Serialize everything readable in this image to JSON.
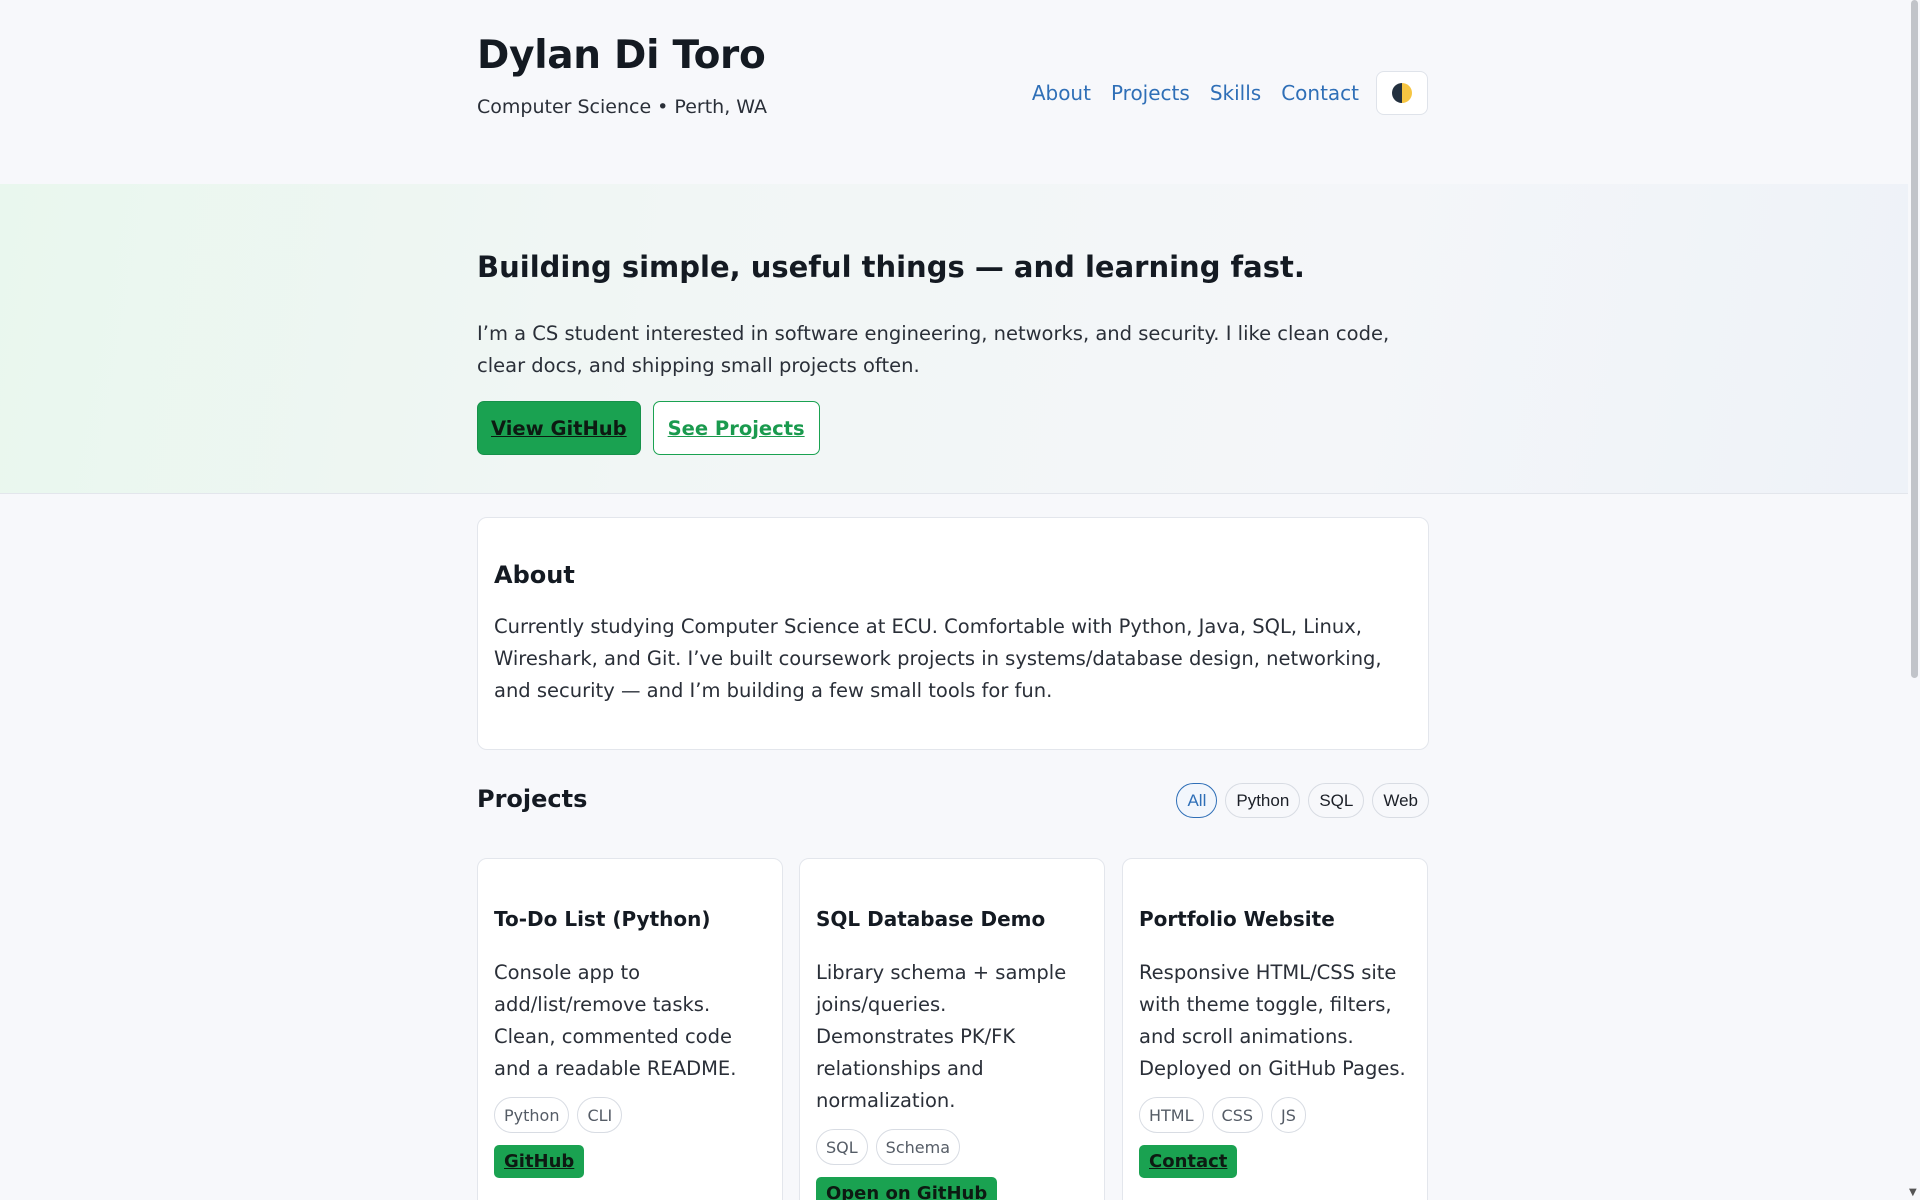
{
  "header": {
    "name": "Dylan Di Toro",
    "subtitle": "Computer Science • Perth, WA",
    "nav": [
      "About",
      "Projects",
      "Skills",
      "Contact"
    ]
  },
  "hero": {
    "title": "Building simple, useful things — and learning fast.",
    "text": "I’m a CS student interested in software engineering, networks, and security. I like clean code, clear docs, and shipping small projects often.",
    "primary_button": "View GitHub",
    "secondary_button": "See Projects"
  },
  "about": {
    "title": "About",
    "text": "Currently studying Computer Science at ECU. Comfortable with Python, Java, SQL, Linux, Wireshark, and Git. I’ve built coursework projects in systems/database design, networking, and security — and I’m building a few small tools for fun."
  },
  "projects": {
    "title": "Projects",
    "filters": [
      "All",
      "Python",
      "SQL",
      "Web"
    ],
    "active_filter": "All",
    "items": [
      {
        "title": "To-Do List (Python)",
        "description": "Console app to add/list/remove tasks. Clean, commented code and a readable README.",
        "tags": [
          "Python",
          "CLI"
        ],
        "button": "GitHub"
      },
      {
        "title": "SQL Database Demo",
        "description": "Library schema + sample joins/queries. Demonstrates PK/FK relationships and normalization.",
        "tags": [
          "SQL",
          "Schema"
        ],
        "button": "Open on GitHub"
      },
      {
        "title": "Portfolio Website",
        "description": "Responsive HTML/CSS site with theme toggle, filters, and scroll animations. Deployed on GitHub Pages.",
        "tags": [
          "HTML",
          "CSS",
          "JS"
        ],
        "button": "Contact"
      }
    ]
  },
  "colors": {
    "accent_green": "#1aa251",
    "link_blue": "#2f6fb7",
    "background": "#f7f8fb"
  },
  "icons": {
    "theme_toggle": "half-moon-theme-icon"
  }
}
